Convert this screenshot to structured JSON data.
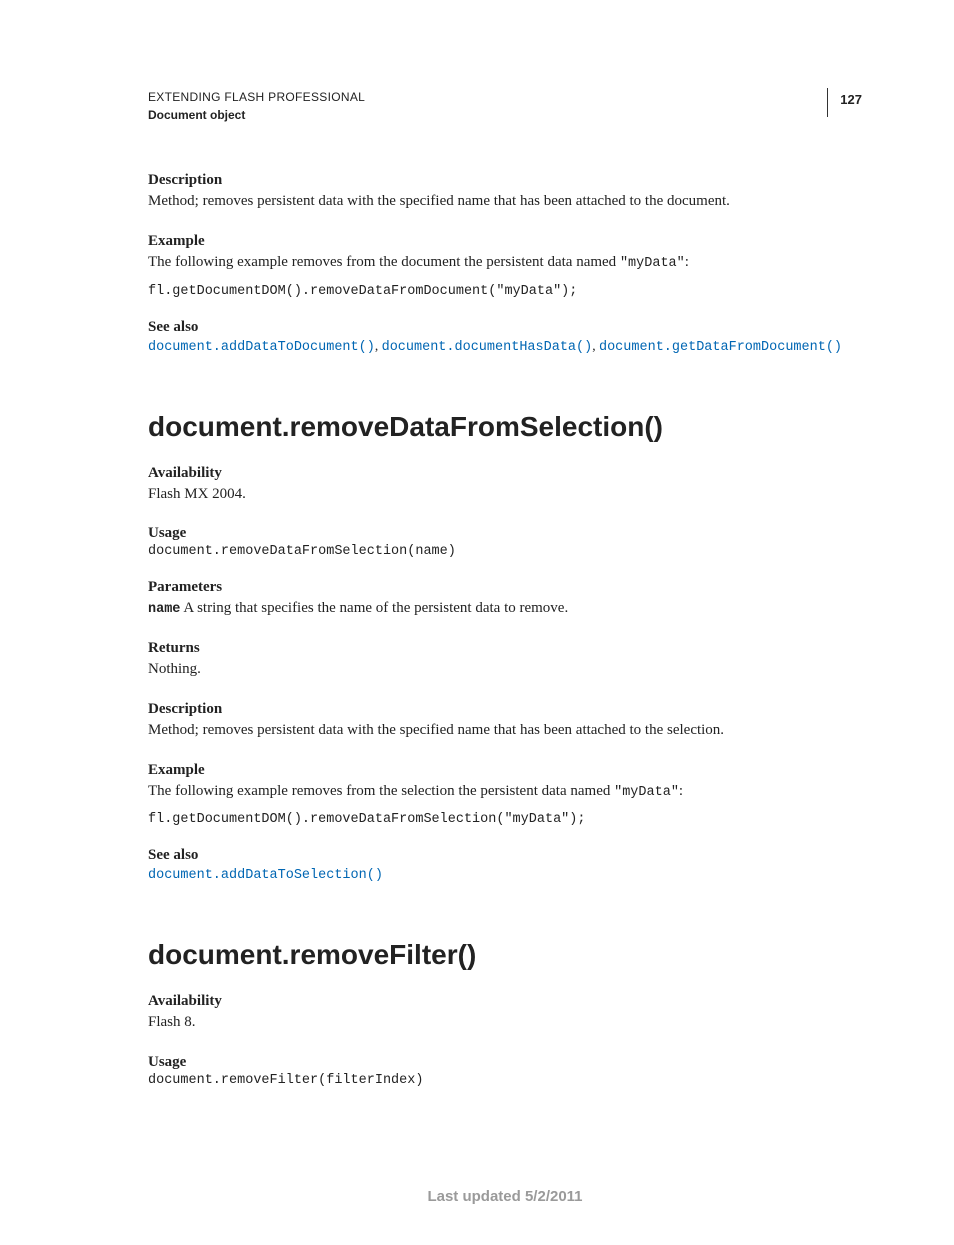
{
  "header": {
    "title": "EXTENDING FLASH PROFESSIONAL",
    "subtitle": "Document object",
    "page_number": "127"
  },
  "section1": {
    "desc_label": "Description",
    "desc_text": "Method; removes persistent data with the specified name that has been attached to the document.",
    "example_label": "Example",
    "example_intro_a": "The following example removes from the document the persistent data named ",
    "example_intro_code": "\"myData\"",
    "example_intro_b": ":",
    "example_code": "fl.getDocumentDOM().removeDataFromDocument(\"myData\");",
    "seealso_label": "See also",
    "links": [
      "document.addDataToDocument()",
      "document.documentHasData()",
      "document.getDataFromDocument()"
    ]
  },
  "section2": {
    "heading": "document.removeDataFromSelection()",
    "avail_label": "Availability",
    "avail_text": "Flash MX 2004.",
    "usage_label": "Usage",
    "usage_code": "document.removeDataFromSelection(name)",
    "params_label": "Parameters",
    "param_name": "name",
    "param_text": "  A string that specifies the name of the persistent data to remove.",
    "returns_label": "Returns",
    "returns_text": "Nothing.",
    "desc_label": "Description",
    "desc_text": "Method; removes persistent data with the specified name that has been attached to the selection.",
    "example_label": "Example",
    "example_intro_a": "The following example removes from the selection the persistent data named ",
    "example_intro_code": "\"myData\"",
    "example_intro_b": ":",
    "example_code": "fl.getDocumentDOM().removeDataFromSelection(\"myData\");",
    "seealso_label": "See also",
    "link": "document.addDataToSelection()"
  },
  "section3": {
    "heading": "document.removeFilter()",
    "avail_label": "Availability",
    "avail_text": "Flash 8.",
    "usage_label": "Usage",
    "usage_code": "document.removeFilter(filterIndex)"
  },
  "footer": "Last updated 5/2/2011"
}
